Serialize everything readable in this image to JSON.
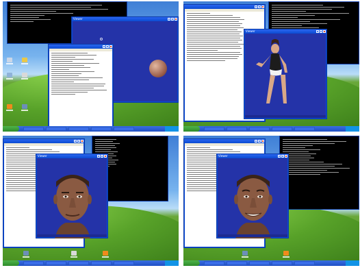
{
  "panels": [
    {
      "id": "top-left",
      "tasks": 5,
      "render_title": "Viewer",
      "notepad_title": "",
      "console_lines": 9,
      "notepad_lines": 24
    },
    {
      "id": "top-right",
      "tasks": 5,
      "render_title": "Viewer",
      "notepad_title": "",
      "console_lines": 12,
      "notepad_lines": 26
    },
    {
      "id": "bottom-left",
      "tasks": 5,
      "render_title": "Viewer",
      "notepad_title": "",
      "console_lines": 14,
      "notepad_lines": 24
    },
    {
      "id": "bottom-right",
      "tasks": 5,
      "render_title": "Viewer",
      "notepad_title": "",
      "console_lines": 18,
      "notepad_lines": 24
    }
  ],
  "colors": {
    "xp_blue": "#0b4bd2",
    "viewport": "#2433a8",
    "start_green": "#3aa33a"
  }
}
